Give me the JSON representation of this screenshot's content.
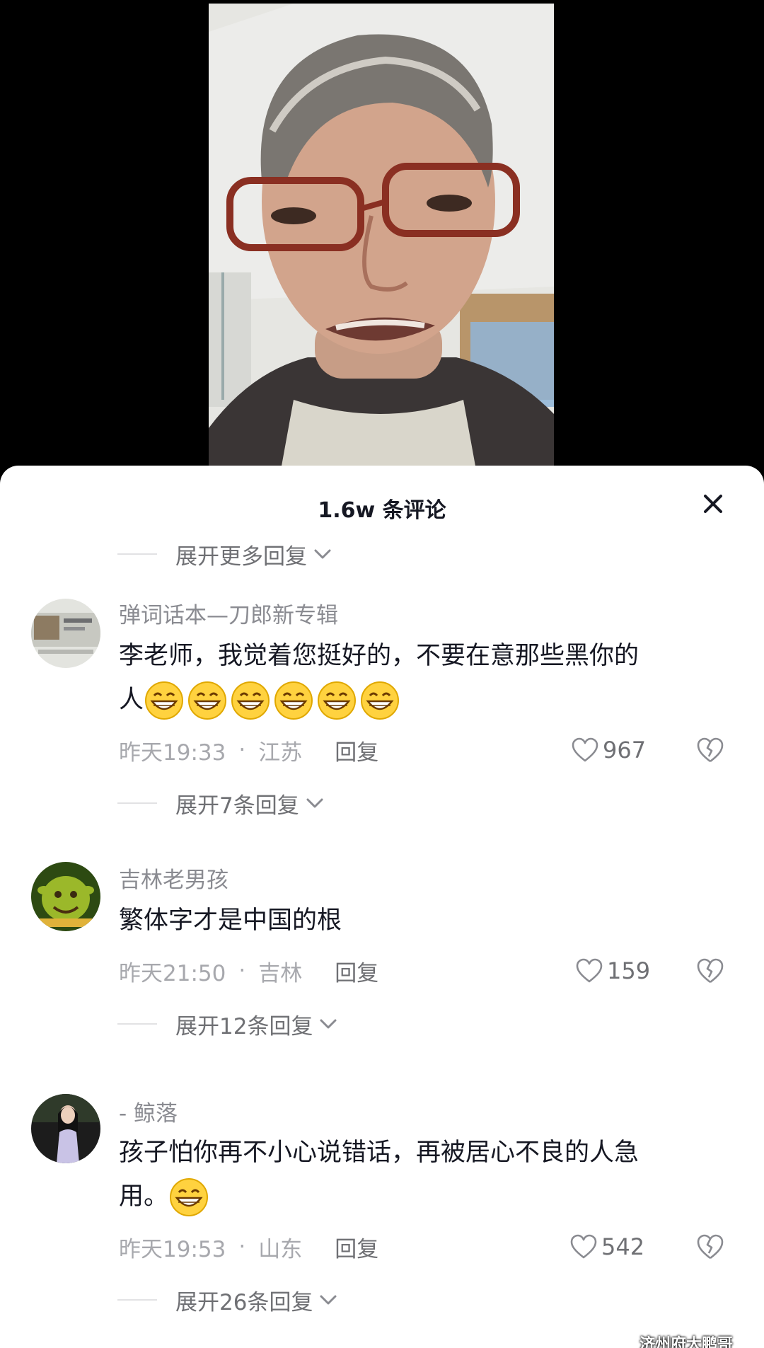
{
  "header": {
    "title": "1.6w 条评论"
  },
  "expand_more_label": "展开更多回复",
  "comments": [
    {
      "username": "弹词话本—刀郎新专辑",
      "text": "李老师，我觉着您挺好的，不要在意那些黑你的",
      "text_line2": "人",
      "emoji_count": 6,
      "time": "昨天19:33",
      "location": "江苏",
      "reply_label": "回复",
      "likes": "967",
      "expand_label": "展开7条回复"
    },
    {
      "username": "吉林老男孩",
      "text": "繁体字才是中国的根",
      "time": "昨天21:50",
      "location": "吉林",
      "reply_label": "回复",
      "likes": "159",
      "expand_label": "展开12条回复"
    },
    {
      "username": "- 鲸落",
      "text": "孩子怕你再不小心说错话，再被居心不良的人急",
      "text_line2": "用。",
      "emoji_count": 1,
      "time": "昨天19:53",
      "location": "山东",
      "reply_label": "回复",
      "likes": "542",
      "expand_label": "展开26条回复"
    }
  ],
  "separator_dot": "·",
  "watermark": "济州府大鹏哥",
  "colors": {
    "primary_text": "#161823",
    "secondary_text": "#8a8b91",
    "meta_text": "#a7a8ad",
    "sheet_bg": "#ffffff",
    "video_bg": "#000000"
  },
  "icons": [
    "close-icon",
    "chevron-down-icon",
    "heart-icon",
    "broken-heart-icon",
    "grin-emoji-icon"
  ]
}
